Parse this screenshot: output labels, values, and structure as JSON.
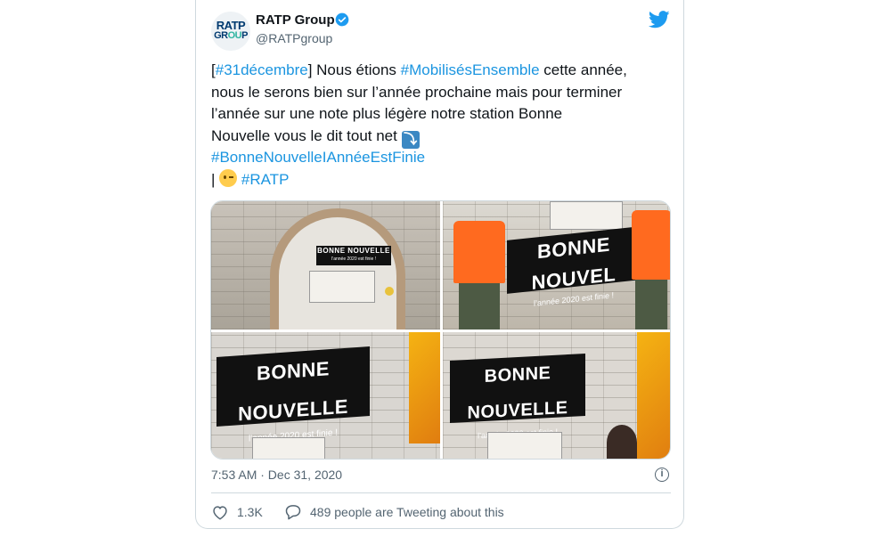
{
  "tweet": {
    "author_name": "RATP Group",
    "author_handle": "@RATPgroup",
    "avatar_line1": "RATP",
    "avatar_line2a": "GR",
    "avatar_line2b": "OU",
    "avatar_line2c": "P",
    "lines": [
      {
        "pre": "[",
        "tag": "#31décembre",
        "post": "] Nous étions ",
        "tag2": "#MobilisésEnsemble",
        "post2": " cette année,"
      },
      {
        "text": "nous le serons bien sur l’année prochaine mais pour terminer"
      },
      {
        "text": "l’année sur une note plus légère notre station Bonne"
      },
      {
        "text": "Nouvelle vous le dit tout net "
      },
      {
        "tag": "#BonneNouvelleIAnnéeEstFinie"
      },
      {
        "pre": " | ",
        "tag": "#RATP"
      }
    ],
    "emoji_arrow": "⤵",
    "timestamp": "7:53 AM · Dec 31, 2020",
    "likes": "1.3K",
    "conversation": "489 people are Tweeting about this"
  },
  "photos": {
    "sign_big": "BONNE NOUVELLE",
    "sign_big_cut": "BONNE NOUVEL",
    "sign_small": "l’année 2020 est finie !"
  },
  "colors": {
    "link": "#1b95e0",
    "secondary_text": "#536471",
    "verified": "#1d9bf0"
  }
}
